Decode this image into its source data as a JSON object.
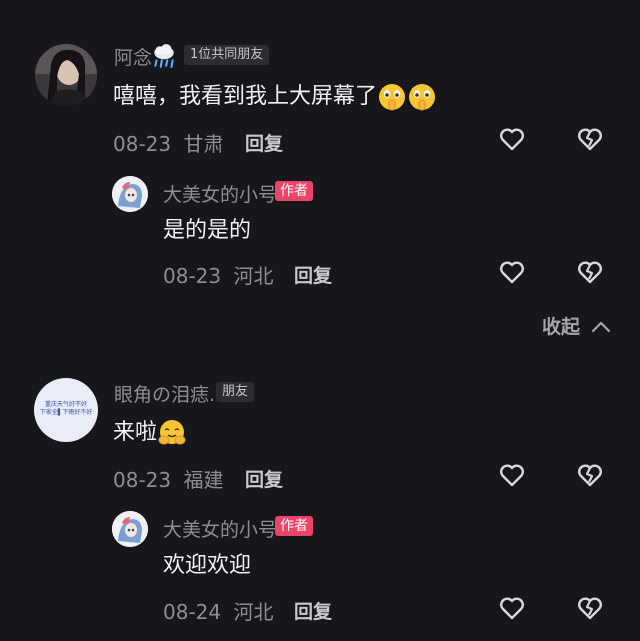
{
  "comments": [
    {
      "user": "阿念",
      "badge": "1位共同朋友",
      "text": "嘻嘻，我看到我上大屏幕了",
      "date": "08-23",
      "location": "甘肃",
      "reply_label": "回复",
      "replies": [
        {
          "user": "大美女的小号",
          "author_badge": "作者",
          "text": "是的是的",
          "date": "08-23",
          "location": "河北",
          "reply_label": "回复"
        }
      ],
      "collapse_label": "收起"
    },
    {
      "user": "眼角の泪痣.",
      "badge": "朋友",
      "avatar_text_line1": "重庆天气好不好",
      "avatar_text_line2": "下家全▌下雨好不好",
      "text": "来啦",
      "date": "08-23",
      "location": "福建",
      "reply_label": "回复",
      "replies": [
        {
          "user": "大美女的小号",
          "author_badge": "作者",
          "text": "欢迎欢迎",
          "date": "08-24",
          "location": "河北",
          "reply_label": "回复"
        }
      ]
    }
  ],
  "icons": {
    "rain": "cloud-rain-icon",
    "like": "heart-outline-icon",
    "dislike": "broken-heart-icon",
    "collapse": "chevron-up-icon"
  },
  "colors": {
    "background": "#17161b",
    "author_badge": "#ec4368",
    "name": "#8e8d93"
  }
}
